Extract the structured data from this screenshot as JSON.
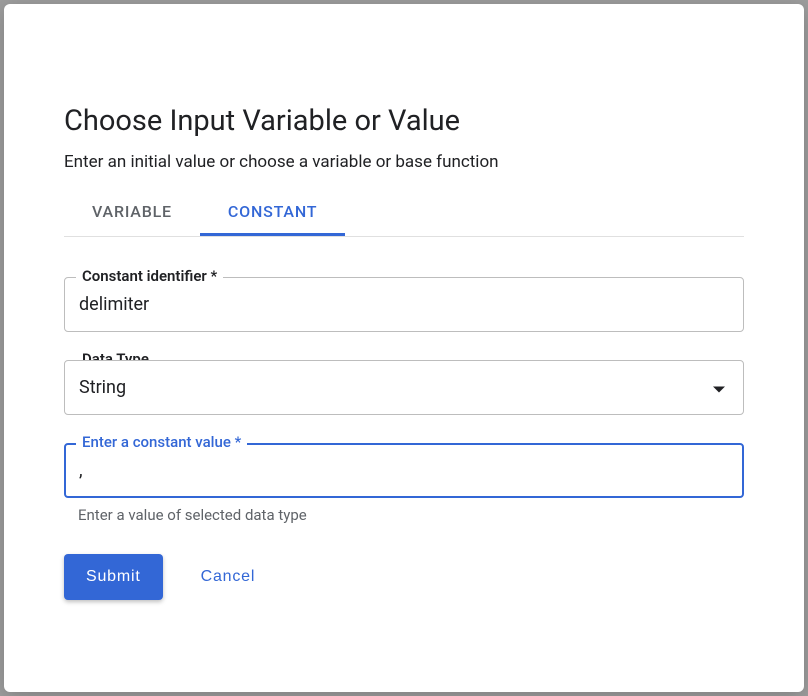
{
  "dialog": {
    "title": "Choose Input Variable or Value",
    "subtitle": "Enter an initial value or choose a variable or base function"
  },
  "tabs": {
    "variable": "Variable",
    "constant": "Constant"
  },
  "fields": {
    "identifier": {
      "label": "Constant identifier *",
      "value": "delimiter"
    },
    "datatype": {
      "label": "Data Type",
      "value": "String"
    },
    "constantvalue": {
      "label": "Enter a constant value *",
      "value": ",",
      "helper": "Enter a value of selected data type"
    }
  },
  "buttons": {
    "submit": "Submit",
    "cancel": "Cancel"
  }
}
